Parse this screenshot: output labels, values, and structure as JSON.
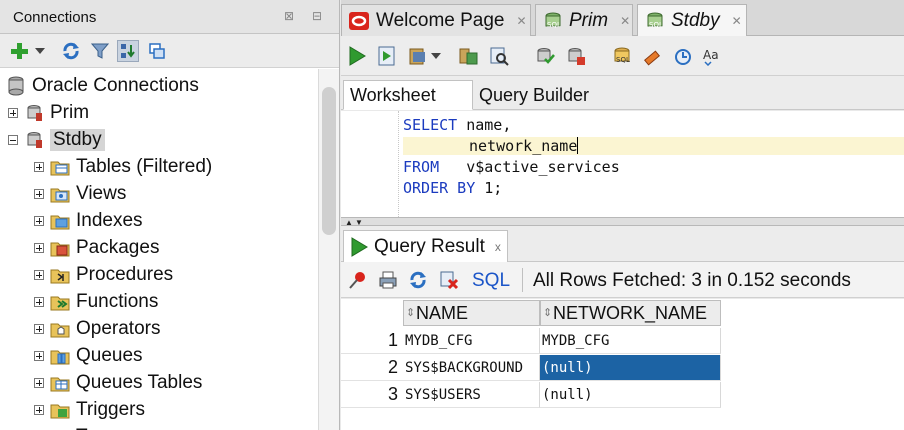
{
  "connections_panel": {
    "title": "Connections",
    "root_label": "Oracle Connections",
    "items": [
      {
        "label": "Prim"
      },
      {
        "label": "Stdby"
      }
    ],
    "children": [
      {
        "label": "Tables (Filtered)",
        "icon": "tables-icon"
      },
      {
        "label": "Views",
        "icon": "views-icon"
      },
      {
        "label": "Indexes",
        "icon": "indexes-icon"
      },
      {
        "label": "Packages",
        "icon": "packages-icon"
      },
      {
        "label": "Procedures",
        "icon": "procedures-icon"
      },
      {
        "label": "Functions",
        "icon": "functions-icon"
      },
      {
        "label": "Operators",
        "icon": "operators-icon"
      },
      {
        "label": "Queues",
        "icon": "queues-icon"
      },
      {
        "label": "Queues Tables",
        "icon": "queues-tables-icon"
      },
      {
        "label": "Triggers",
        "icon": "triggers-icon"
      },
      {
        "label": "T",
        "icon": "folder-icon"
      }
    ]
  },
  "editor_tabs": [
    {
      "label": "Welcome Page",
      "icon": "oracle-icon"
    },
    {
      "label": "Prim",
      "icon": "sql-worksheet-icon"
    },
    {
      "label": "Stdby",
      "icon": "sql-worksheet-icon"
    }
  ],
  "worksheet_tabs": {
    "worksheet": "Worksheet",
    "query_builder": "Query Builder"
  },
  "sql": {
    "line1_kw": "SELECT",
    "line1_rest": " name,",
    "line2": "network_name",
    "line3_kw": "FROM",
    "line3_rest": "   v$active_services",
    "line4_kw": "ORDER BY",
    "line4_rest": " 1;"
  },
  "query_result": {
    "tab_label": "Query Result",
    "sql_link": "SQL",
    "status": "All Rows Fetched: 3 in 0.152 seconds",
    "columns": [
      "NAME",
      "NETWORK_NAME"
    ],
    "rows": [
      {
        "num": "1",
        "name": "MYDB_CFG",
        "network_name": "MYDB_CFG"
      },
      {
        "num": "2",
        "name": "SYS$BACKGROUND",
        "network_name": "(null)"
      },
      {
        "num": "3",
        "name": "SYS$USERS",
        "network_name": "(null)"
      }
    ]
  },
  "colors": {
    "keyword": "#1b3bbf",
    "selection": "#1c63a4",
    "link": "#1b55c8"
  }
}
